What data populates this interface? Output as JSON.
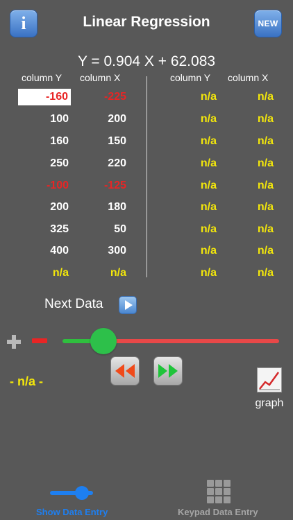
{
  "header": {
    "info_label": "i",
    "title": "Linear Regression",
    "new_label": "NEW"
  },
  "equation": "Y = 0.904 X + 62.083",
  "table_left": {
    "headers": [
      "column Y",
      "column X"
    ],
    "rows": [
      {
        "y": "-160",
        "x": "-225"
      },
      {
        "y": "100",
        "x": "200"
      },
      {
        "y": "160",
        "x": "150"
      },
      {
        "y": "250",
        "x": "220"
      },
      {
        "y": "-100",
        "x": "-125"
      },
      {
        "y": "200",
        "x": "180"
      },
      {
        "y": "325",
        "x": "50"
      },
      {
        "y": "400",
        "x": "300"
      },
      {
        "y": "n/a",
        "x": "n/a"
      }
    ]
  },
  "table_right": {
    "headers": [
      "column Y",
      "column X"
    ],
    "rows": [
      {
        "y": "n/a",
        "x": "n/a"
      },
      {
        "y": "n/a",
        "x": "n/a"
      },
      {
        "y": "n/a",
        "x": "n/a"
      },
      {
        "y": "n/a",
        "x": "n/a"
      },
      {
        "y": "n/a",
        "x": "n/a"
      },
      {
        "y": "n/a",
        "x": "n/a"
      },
      {
        "y": "n/a",
        "x": "n/a"
      },
      {
        "y": "n/a",
        "x": "n/a"
      },
      {
        "y": "n/a",
        "x": "n/a"
      }
    ]
  },
  "next_data_label": "Next Data",
  "slider": {
    "value_fraction": 0.19
  },
  "status_value": "- n/a -",
  "graph_label": "graph",
  "tabs": [
    {
      "label": "Show Data Entry",
      "active": true
    },
    {
      "label": "Keypad Data Entry",
      "active": false
    }
  ],
  "icons": {
    "info": "info-icon",
    "new": "new-icon",
    "next": "play-icon",
    "plus": "plus-icon",
    "minus": "minus-icon",
    "rewind": "rewind-icon",
    "forward": "fast-forward-icon",
    "graph": "graph-icon",
    "slider_tab": "slider-icon",
    "keypad_tab": "keypad-icon"
  },
  "colors": {
    "accent": "#1e7ff0",
    "negative": "#e82525",
    "na": "#f3e70b",
    "slider_active": "#2fbf3e",
    "slider_inactive": "#e84848"
  }
}
